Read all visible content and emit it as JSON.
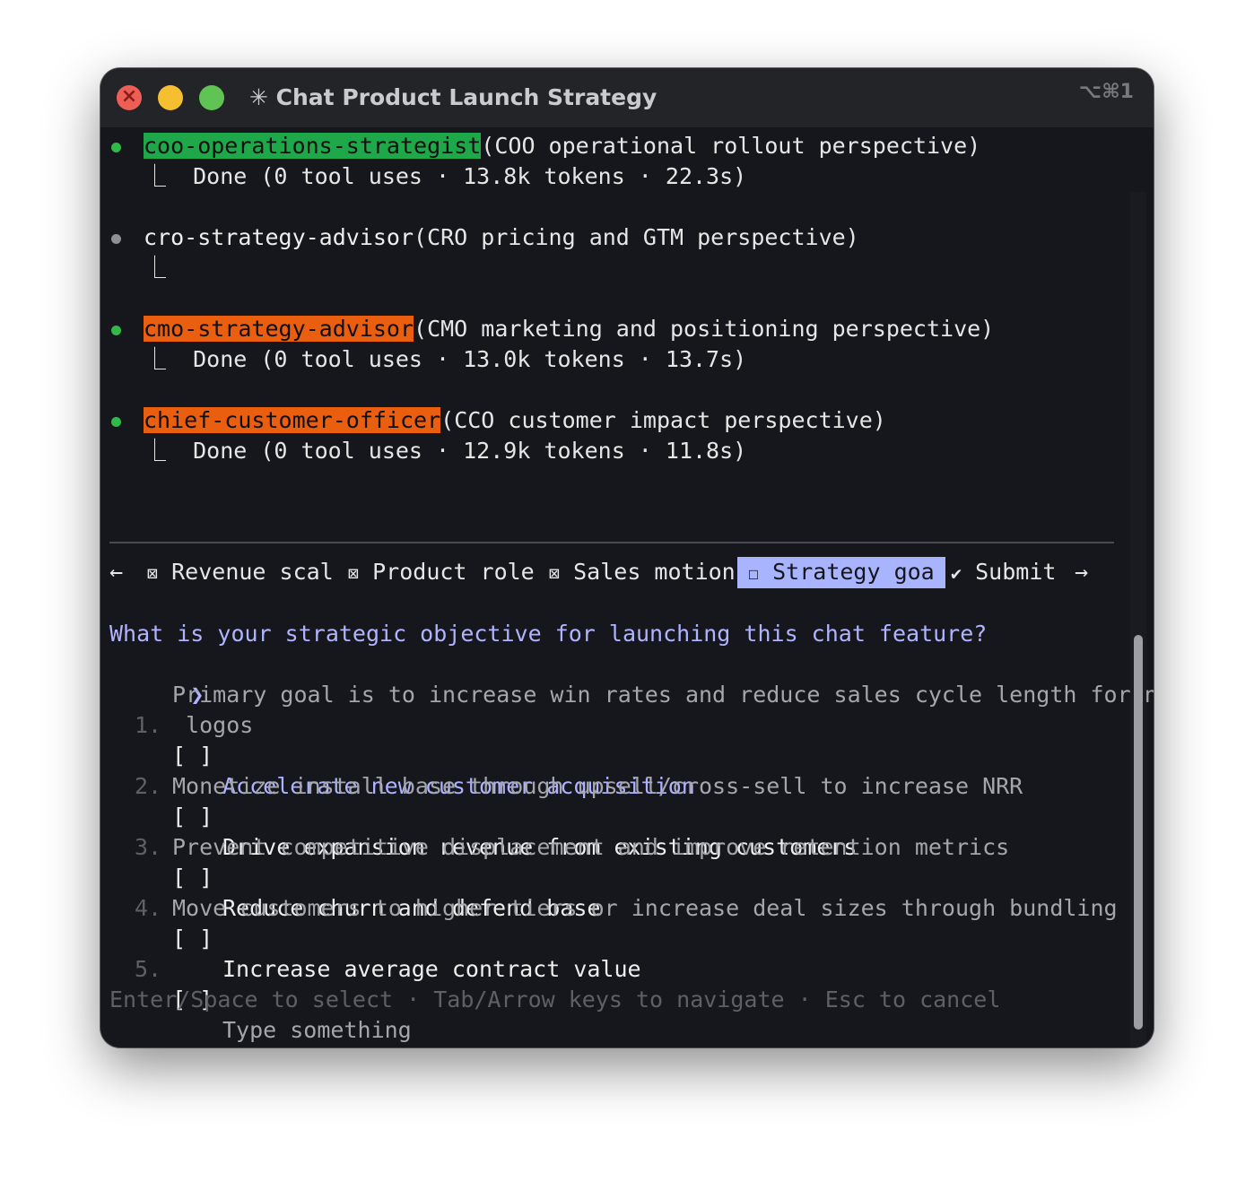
{
  "window": {
    "title": "✳ Chat Product Launch Strategy",
    "shortcut": "⌥⌘1"
  },
  "agents": [
    {
      "name": "coo-operations-strategist",
      "desc": "(COO operational rollout perspective)",
      "status": "⎿  Done (0 tool uses · 13.8k tokens · 22.3s)",
      "dot": "green",
      "highlight": "#1fa84a"
    },
    {
      "name": "cro-strategy-advisor",
      "desc": "(CRO pricing and GTM perspective)",
      "status": "⎿",
      "dot": "gray",
      "highlight": ""
    },
    {
      "name": "cmo-strategy-advisor",
      "desc": "(CMO marketing and positioning perspective)",
      "status": "⎿  Done (0 tool uses · 13.0k tokens · 13.7s)",
      "dot": "green",
      "highlight": "#ea5e10"
    },
    {
      "name": "chief-customer-officer",
      "desc": "(CCO customer impact perspective)",
      "status": "⎿  Done (0 tool uses · 12.9k tokens · 11.8s)",
      "dot": "green",
      "highlight": "#ea5e10"
    }
  ],
  "tabs": {
    "left_arrow": "←",
    "items": [
      {
        "icon": "⊠",
        "label": "Revenue scal"
      },
      {
        "icon": "⊠",
        "label": "Product role"
      },
      {
        "icon": "⊠",
        "label": "Sales motion"
      },
      {
        "icon": "☐",
        "label": "Strategy goa",
        "active": true
      },
      {
        "icon": "✔",
        "label": "Submit"
      }
    ],
    "right_arrow": "→"
  },
  "question": "What is your strategic objective for launching this chat feature?",
  "cursor": "❯",
  "options": [
    {
      "num": "1.",
      "checkbox": "[ ]",
      "label": "Accelerate new customer acquisition",
      "desc": [
        "Primary goal is to increase win rates and reduce sales cycle length for new",
        " logos"
      ],
      "selected": true
    },
    {
      "num": "2.",
      "checkbox": "[ ]",
      "label": "Drive expansion revenue from existing customers",
      "desc": [
        "Monetize install base through upsell/cross-sell to increase NRR"
      ]
    },
    {
      "num": "3.",
      "checkbox": "[ ]",
      "label": "Reduce churn and defend base",
      "desc": [
        "Prevent competitive displacement and improve retention metrics"
      ]
    },
    {
      "num": "4.",
      "checkbox": "[ ]",
      "label": "Increase average contract value",
      "desc": [
        "Move customers to higher tiers or increase deal sizes through bundling"
      ]
    },
    {
      "num": "5.",
      "checkbox": "[ ]",
      "label": "Type something",
      "desc": []
    }
  ],
  "footer": "Enter/Space to select · Tab/Arrow keys to navigate · Esc to cancel"
}
